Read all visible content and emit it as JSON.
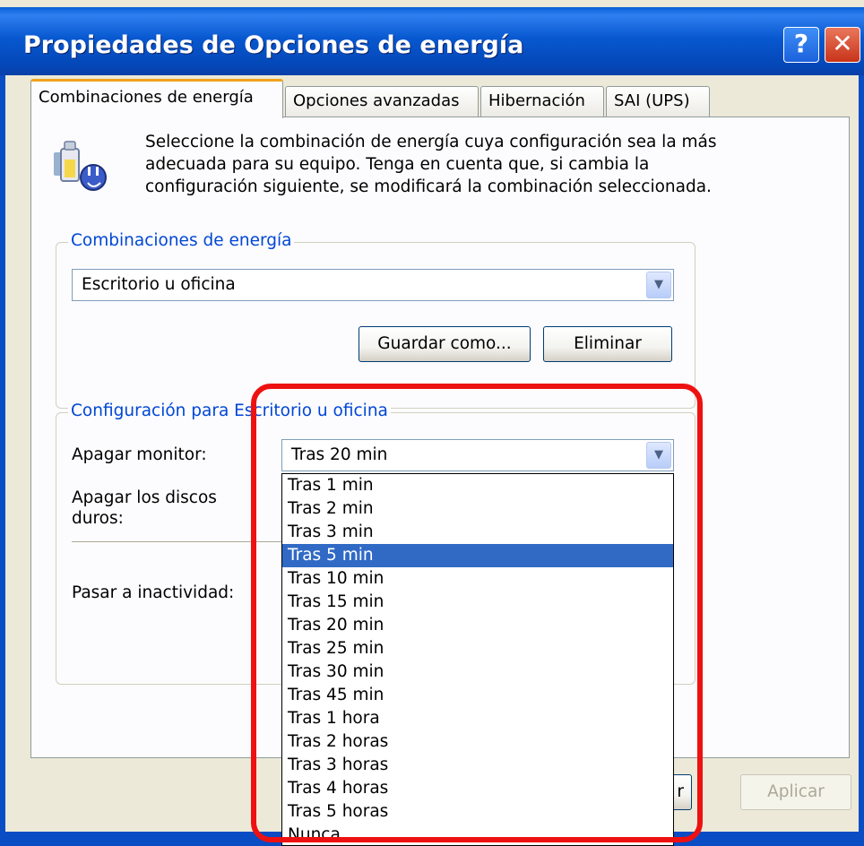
{
  "window": {
    "title": "Propiedades de Opciones de energía",
    "help_glyph": "?",
    "close_glyph": "✕"
  },
  "tabs": [
    {
      "label": "Combinaciones de energía",
      "active": true
    },
    {
      "label": "Opciones avanzadas",
      "active": false
    },
    {
      "label": "Hibernación",
      "active": false
    },
    {
      "label": "SAI (UPS)",
      "active": false
    }
  ],
  "intro_text": "Seleccione la combinación de energía  cuya configuración sea la más adecuada para su equipo. Tenga en cuenta que, si cambia la configuración siguiente, se modificará la combinación seleccionada.",
  "power_schemes": {
    "group_label": "Combinaciones de energía",
    "selected": "Escritorio u oficina",
    "save_as_label": "Guardar como...",
    "delete_label": "Eliminar"
  },
  "settings": {
    "group_label": "Configuración para Escritorio u oficina",
    "monitor_label": "Apagar monitor:",
    "monitor_value": "Tras 20 min",
    "disks_label": "Apagar los discos duros:",
    "standby_label": "Pasar a inactividad:"
  },
  "dropdown": {
    "options": [
      "Tras 1 min",
      "Tras 2 min",
      "Tras 3 min",
      "Tras 5 min",
      "Tras 10 min",
      "Tras 15 min",
      "Tras 20 min",
      "Tras 25 min",
      "Tras 30 min",
      "Tras 45 min",
      "Tras 1 hora",
      "Tras 2 horas",
      "Tras 3 horas",
      "Tras 4 horas",
      "Tras 5 horas",
      "Nunca"
    ],
    "highlighted": "Tras 5 min"
  },
  "footer": {
    "apply_label": "Aplicar",
    "hidden_button_fragment": "r"
  },
  "colors": {
    "title_bar": "#0a58d0",
    "annotation": "#ee1111",
    "selection": "#316ac5",
    "group_label": "#0046d5"
  }
}
